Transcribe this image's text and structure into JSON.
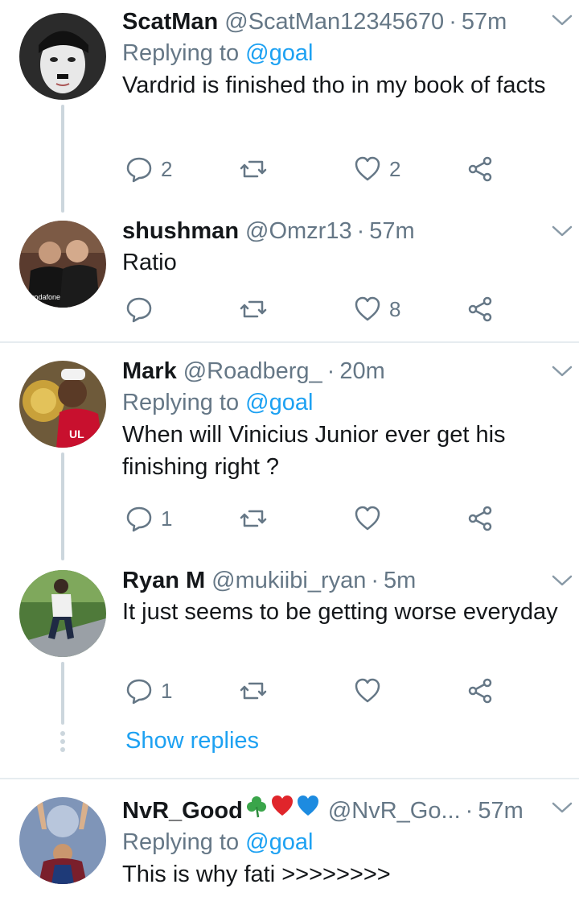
{
  "tweets": [
    {
      "name": "ScatMan",
      "handle": "@ScatMan12345670",
      "dot": "·",
      "time": "57m",
      "replying_prefix": "Replying to",
      "replying_mention": "@goal",
      "text": "Vardrid is finished tho in my book of facts",
      "reply_count": "2",
      "retweet_count": "",
      "like_count": "2",
      "avatar_icon": "avatar-face-icon"
    },
    {
      "name": "shushman",
      "handle": "@Omzr13",
      "dot": "·",
      "time": "57m",
      "text": "Ratio",
      "reply_count": "",
      "retweet_count": "",
      "like_count": "8",
      "avatar_icon": "avatar-photo-icon"
    },
    {
      "name": "Mark",
      "handle": "@Roadberg_",
      "dot": "·",
      "time": "20m",
      "replying_prefix": "Replying to",
      "replying_mention": "@goal",
      "text": "When will Vinicius Junior ever get his finishing right ?",
      "reply_count": "1",
      "retweet_count": "",
      "like_count": "",
      "avatar_icon": "avatar-photo-icon"
    },
    {
      "name": "Ryan M",
      "handle": "@mukiibi_ryan",
      "dot": "·",
      "time": "5m",
      "text": "It just seems to be getting worse everyday",
      "reply_count": "1",
      "retweet_count": "",
      "like_count": "",
      "avatar_icon": "avatar-photo-icon"
    },
    {
      "name": "NvR_Good",
      "handle": "@NvR_Go...",
      "dot": "·",
      "time": "57m",
      "replying_prefix": "Replying to",
      "replying_mention": "@goal",
      "text": "This is why fati >>>>>>>>",
      "name_emojis": [
        "shamrock-icon",
        "red-heart-icon",
        "blue-heart-icon"
      ],
      "avatar_icon": "avatar-photo-icon"
    }
  ],
  "show_replies_label": "Show replies",
  "colors": {
    "link": "#1da1f2",
    "secondary_text": "#657786",
    "thread_line": "#ccd6dd",
    "separator": "#e6ecf0"
  }
}
